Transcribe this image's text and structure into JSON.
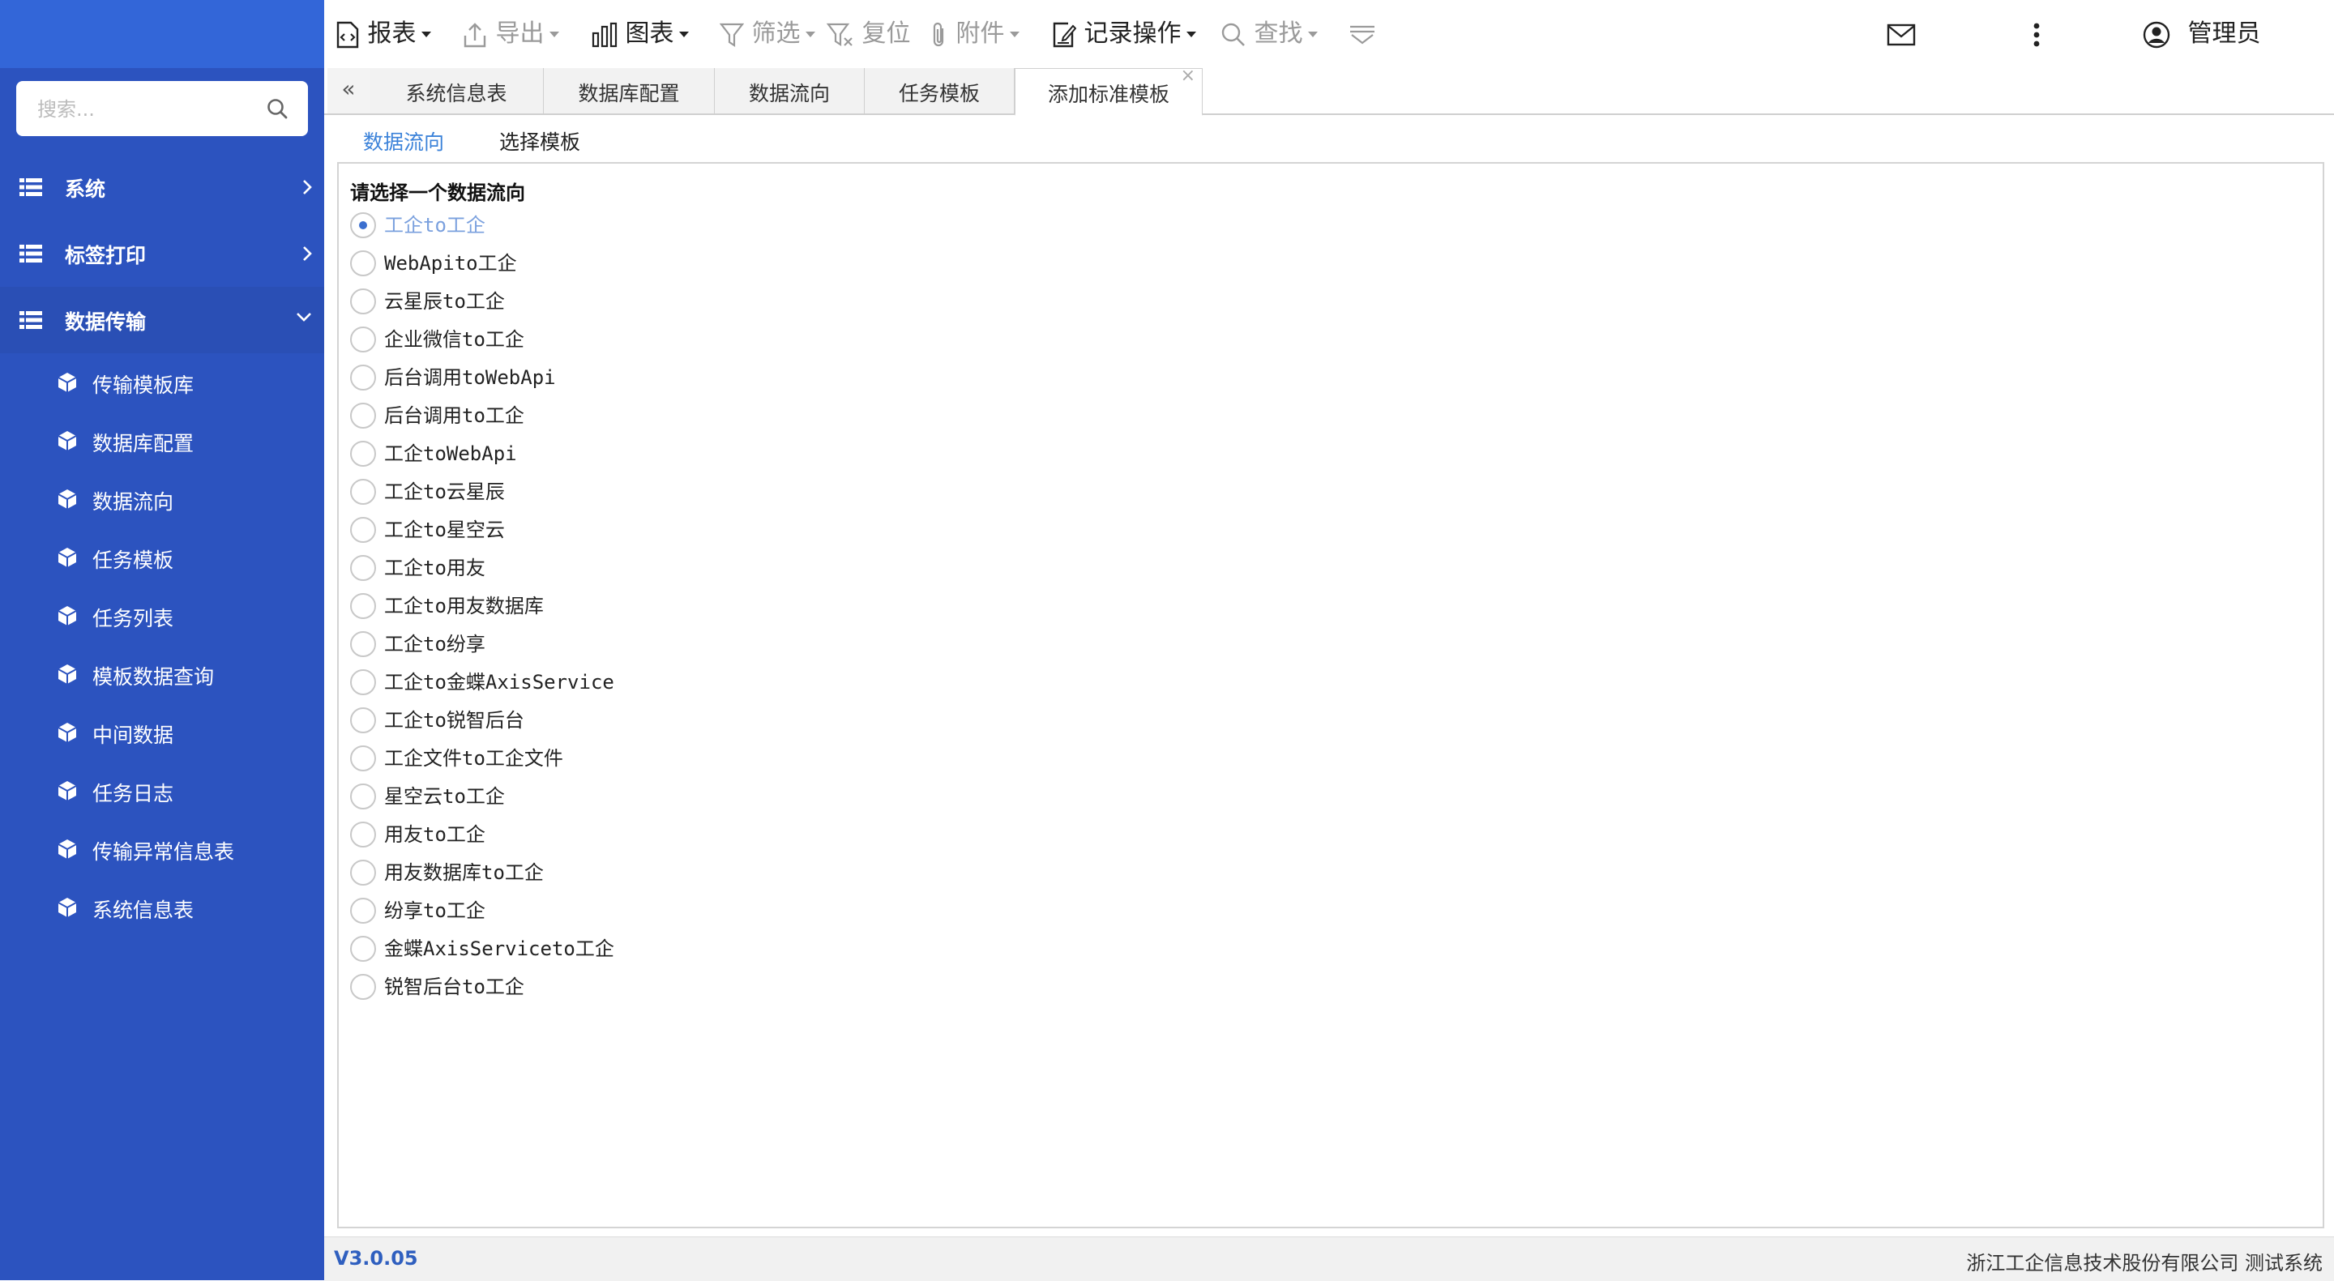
{
  "search": {
    "placeholder": "搜索..."
  },
  "sidebar": {
    "top_items": [
      {
        "label": "系统"
      },
      {
        "label": "标签打印"
      },
      {
        "label": "数据传输"
      }
    ],
    "sub_items": [
      {
        "label": "传输模板库"
      },
      {
        "label": "数据库配置"
      },
      {
        "label": "数据流向"
      },
      {
        "label": "任务模板"
      },
      {
        "label": "任务列表"
      },
      {
        "label": "模板数据查询"
      },
      {
        "label": "中间数据"
      },
      {
        "label": "任务日志"
      },
      {
        "label": "传输异常信息表"
      },
      {
        "label": "系统信息表"
      }
    ]
  },
  "toolbar": {
    "report": "报表",
    "export": "导出",
    "chart": "图表",
    "filter": "筛选",
    "reset": "复位",
    "attachment": "附件",
    "record_ops": "记录操作",
    "find": "查找",
    "user": "管理员"
  },
  "tabs": [
    {
      "label": "系统信息表"
    },
    {
      "label": "数据库配置"
    },
    {
      "label": "数据流向"
    },
    {
      "label": "任务模板"
    },
    {
      "label": "添加标准模板"
    }
  ],
  "subtabs": {
    "active": "数据流向",
    "other": "选择模板"
  },
  "panel": {
    "title": "请选择一个数据流向",
    "options": [
      "工企to工企",
      "WebApito工企",
      "云星辰to工企",
      "企业微信to工企",
      "后台调用toWebApi",
      "后台调用to工企",
      "工企toWebApi",
      "工企to云星辰",
      "工企to星空云",
      "工企to用友",
      "工企to用友数据库",
      "工企to纷享",
      "工企to金蝶AxisService",
      "工企to锐智后台",
      "工企文件to工企文件",
      "星空云to工企",
      "用友to工企",
      "用友数据库to工企",
      "纷享to工企",
      "金蝶AxisServiceto工企",
      "锐智后台to工企"
    ],
    "selected_index": 0
  },
  "status": {
    "version": "V3.0.05",
    "company": "浙江工企信息技术股份有限公司 测试系统"
  },
  "colors": {
    "sidebar": "#2c53bf",
    "accent": "#3b82d9"
  }
}
